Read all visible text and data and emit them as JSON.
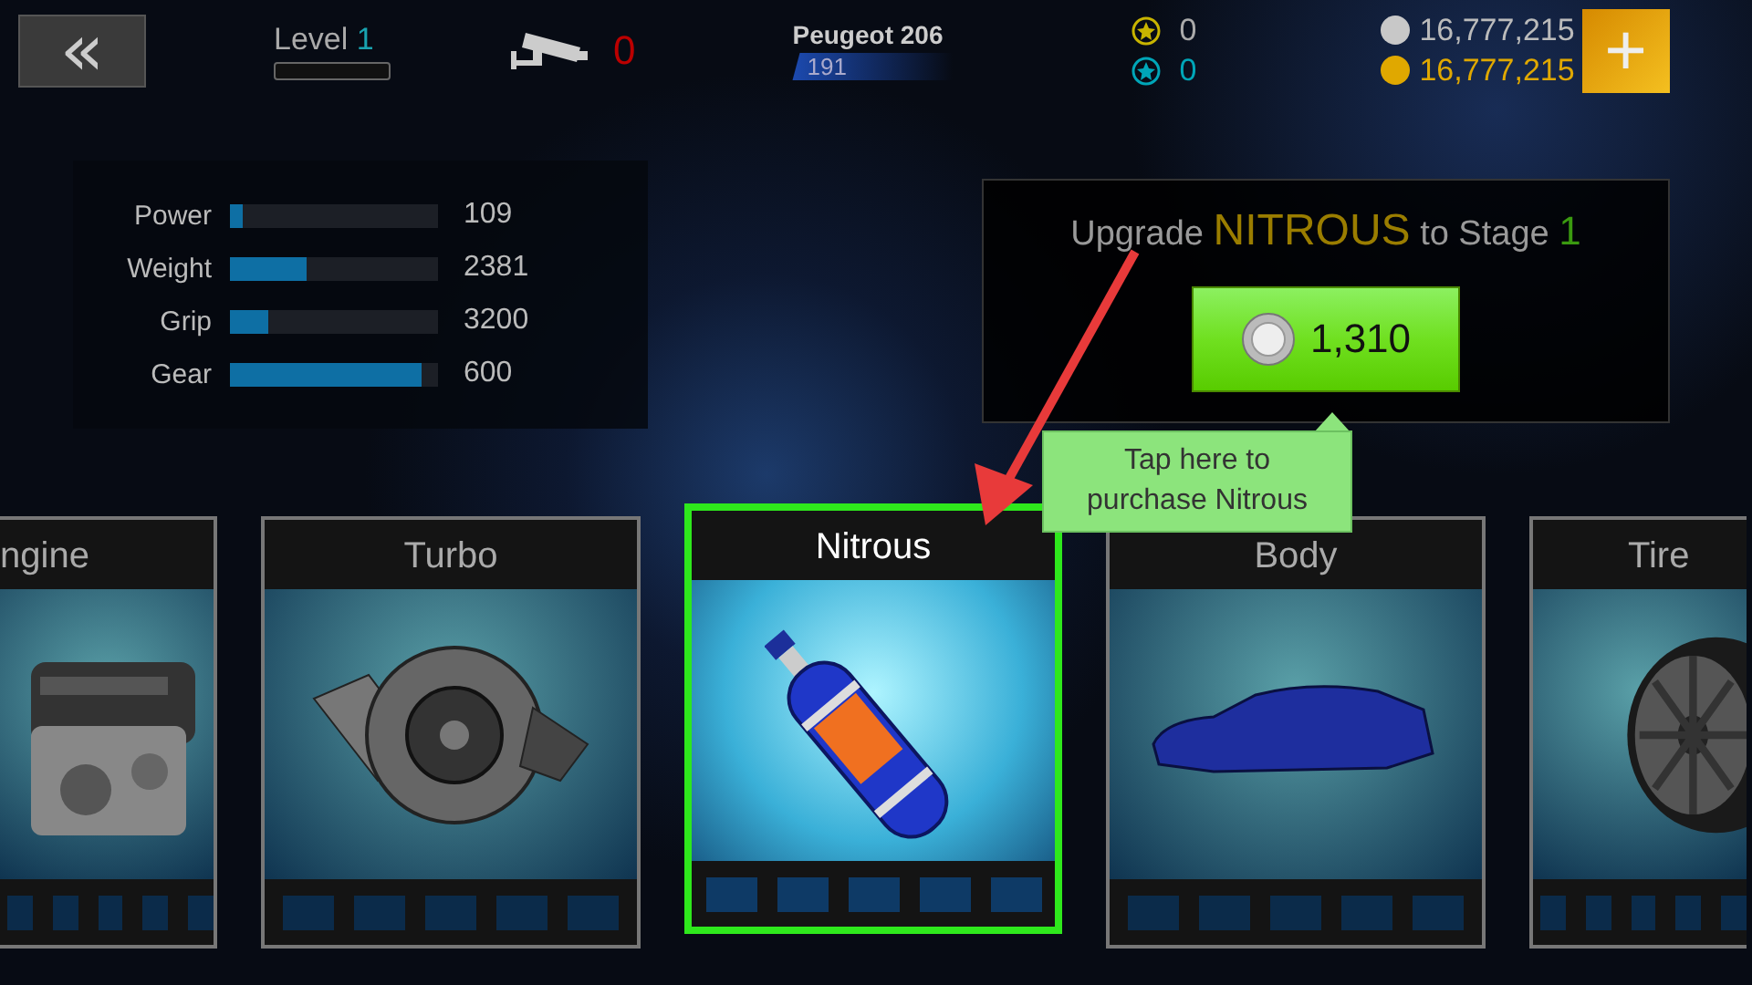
{
  "top_bar": {
    "back_icon": "«",
    "level": {
      "label": "Level",
      "value": "1",
      "level": 0
    },
    "wanted": {
      "count": "0"
    },
    "car": {
      "name": "Peugeot 206",
      "rating": "191"
    },
    "stars": [
      {
        "count": "0",
        "color": "#c8b400"
      },
      {
        "count": "0",
        "color": "#00a6b8"
      }
    ],
    "currencies": [
      {
        "amount": "16,777,215",
        "color": "#c8c8c8"
      },
      {
        "amount": "16,777,215",
        "color": "#e0a800"
      }
    ],
    "add_button": "+"
  },
  "stats": [
    {
      "name": "Power",
      "level": 0.06,
      "value": "109"
    },
    {
      "name": "Weight",
      "level": 0.37,
      "value": "2381"
    },
    {
      "name": "Grip",
      "level": 0.18,
      "value": "3200"
    },
    {
      "name": "Gear",
      "level": 0.92,
      "value": "600"
    }
  ],
  "upgrade": {
    "lead": "Upgrade",
    "part": "NITROUS",
    "mid": "to Stage",
    "stage": "1",
    "price": "1,310"
  },
  "tooltip": {
    "text": "Tap here to purchase Nitrous"
  },
  "parts": [
    {
      "kind": "engine",
      "label": "ngine",
      "selected": false
    },
    {
      "kind": "turbo",
      "label": "Turbo",
      "selected": false
    },
    {
      "kind": "nitrous",
      "label": "Nitrous",
      "selected": true
    },
    {
      "kind": "body",
      "label": "Body",
      "selected": false
    },
    {
      "kind": "tire",
      "label": "Tire",
      "selected": false
    }
  ]
}
